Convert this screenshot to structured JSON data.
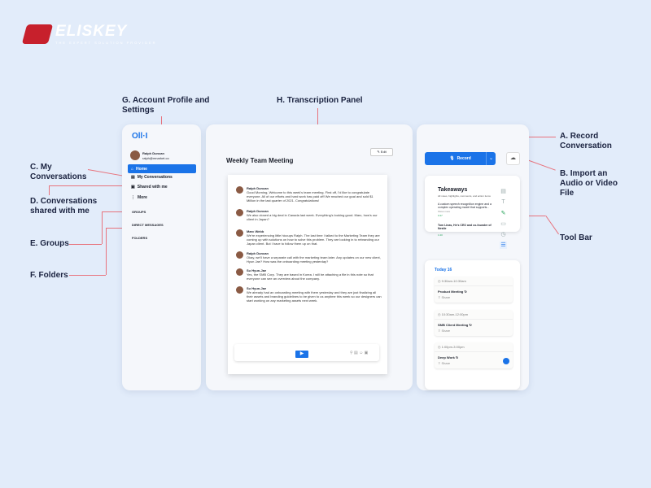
{
  "brand": {
    "name": "ELISKEY",
    "tagline": "THE EXPERT SOLUTION PROVIDER",
    "color": "#c7202c"
  },
  "annotations": {
    "a": "A. Record Conversation",
    "b": "B. Import an Audio or Video File",
    "toolbar": "Tool Bar",
    "c": "C. My Conversations",
    "d": "D. Conversations shared with me",
    "e": "E. Groups",
    "f": "F. Folders",
    "g": "G. Account Profile and Settings",
    "h": "H. Transcription Panel"
  },
  "annotation_color": "#e8737d",
  "sidebar": {
    "app_logo": "Oll·I",
    "user": {
      "name": "Ralph Duncan",
      "email": "ralph@mnarket.co"
    },
    "items": [
      {
        "label": "Home",
        "icon": "home-icon",
        "active": true
      },
      {
        "label": "My Conversations",
        "icon": "document-icon"
      },
      {
        "label": "Shared with me",
        "icon": "shared-icon"
      },
      {
        "label": "More",
        "icon": "more-vertical-icon"
      }
    ],
    "sections": [
      "GROUPS",
      "DIRECT MESSAGES",
      "FOLDERS"
    ]
  },
  "transcript": {
    "title": "Weekly Team Meeting",
    "edit_label": "Edit",
    "messages": [
      {
        "speaker": "Ralph Duncan",
        "text": "Good Morning, Welcome to this week's team meeting. First off, I'd like to congratulate everyone. All of our efforts and hard work has paid off! We reached our goal and sold $1 Million in the last quarter of 2021. Congratulations!"
      },
      {
        "speaker": "Ralph Duncan",
        "text": "We also closed a big deal in Canada last week. Everything's looking good. Marc, how's our client in Japan?"
      },
      {
        "speaker": "Marc Webb",
        "text": "We're experiencing little hiccups Ralph. The last time I talked to the Marketing Team they are coming up with solutions on how to solve this problem. They are looking in to rebranding our Japan client. But I have to follow them up on that."
      },
      {
        "speaker": "Ralph Duncan",
        "text": "Okay, we'll have a separate call with the marketing team later.  Any updates on our new client, Hyun Jae? How was the onboarding meeting yesterday?"
      },
      {
        "speaker": "Su Hyun-Jae",
        "text": "Yes, the SMB Corp. They are based in Korea. I will be attaching a file in this note so that everyone can see an overview about the company."
      },
      {
        "speaker": "Su Hyun-Jae",
        "text": "We already had an onboarding meeting with them yesterday and they are just finalizing all their assets and branding guidelines to be given to us anytime this week so our designers can start working on any marketing assets next week."
      }
    ]
  },
  "right": {
    "record_label": "Record",
    "accent": "#1a73e8",
    "takeaways": {
      "title": "Takeaways",
      "subtitle": "All notes, highlights, comments, and action items",
      "items": [
        {
          "text": "A custom speech recognition engine and a complex operating model that supports...",
          "more": "Show more",
          "time": "0:47"
        },
        {
          "text": "Tom Linas, He's CEO and co-founder of Nestle",
          "time": "1:20"
        }
      ]
    },
    "day": "Today 16",
    "events": [
      {
        "time": "9:30am-10:30am",
        "title": "Product Meeting",
        "share": "Share"
      },
      {
        "time": "10:30am-12:00pm",
        "title": "SMB Client Meeting",
        "share": "Share"
      },
      {
        "time": "1:00pm-3:00pm",
        "title": "Deep Work",
        "share": "Share"
      }
    ]
  }
}
